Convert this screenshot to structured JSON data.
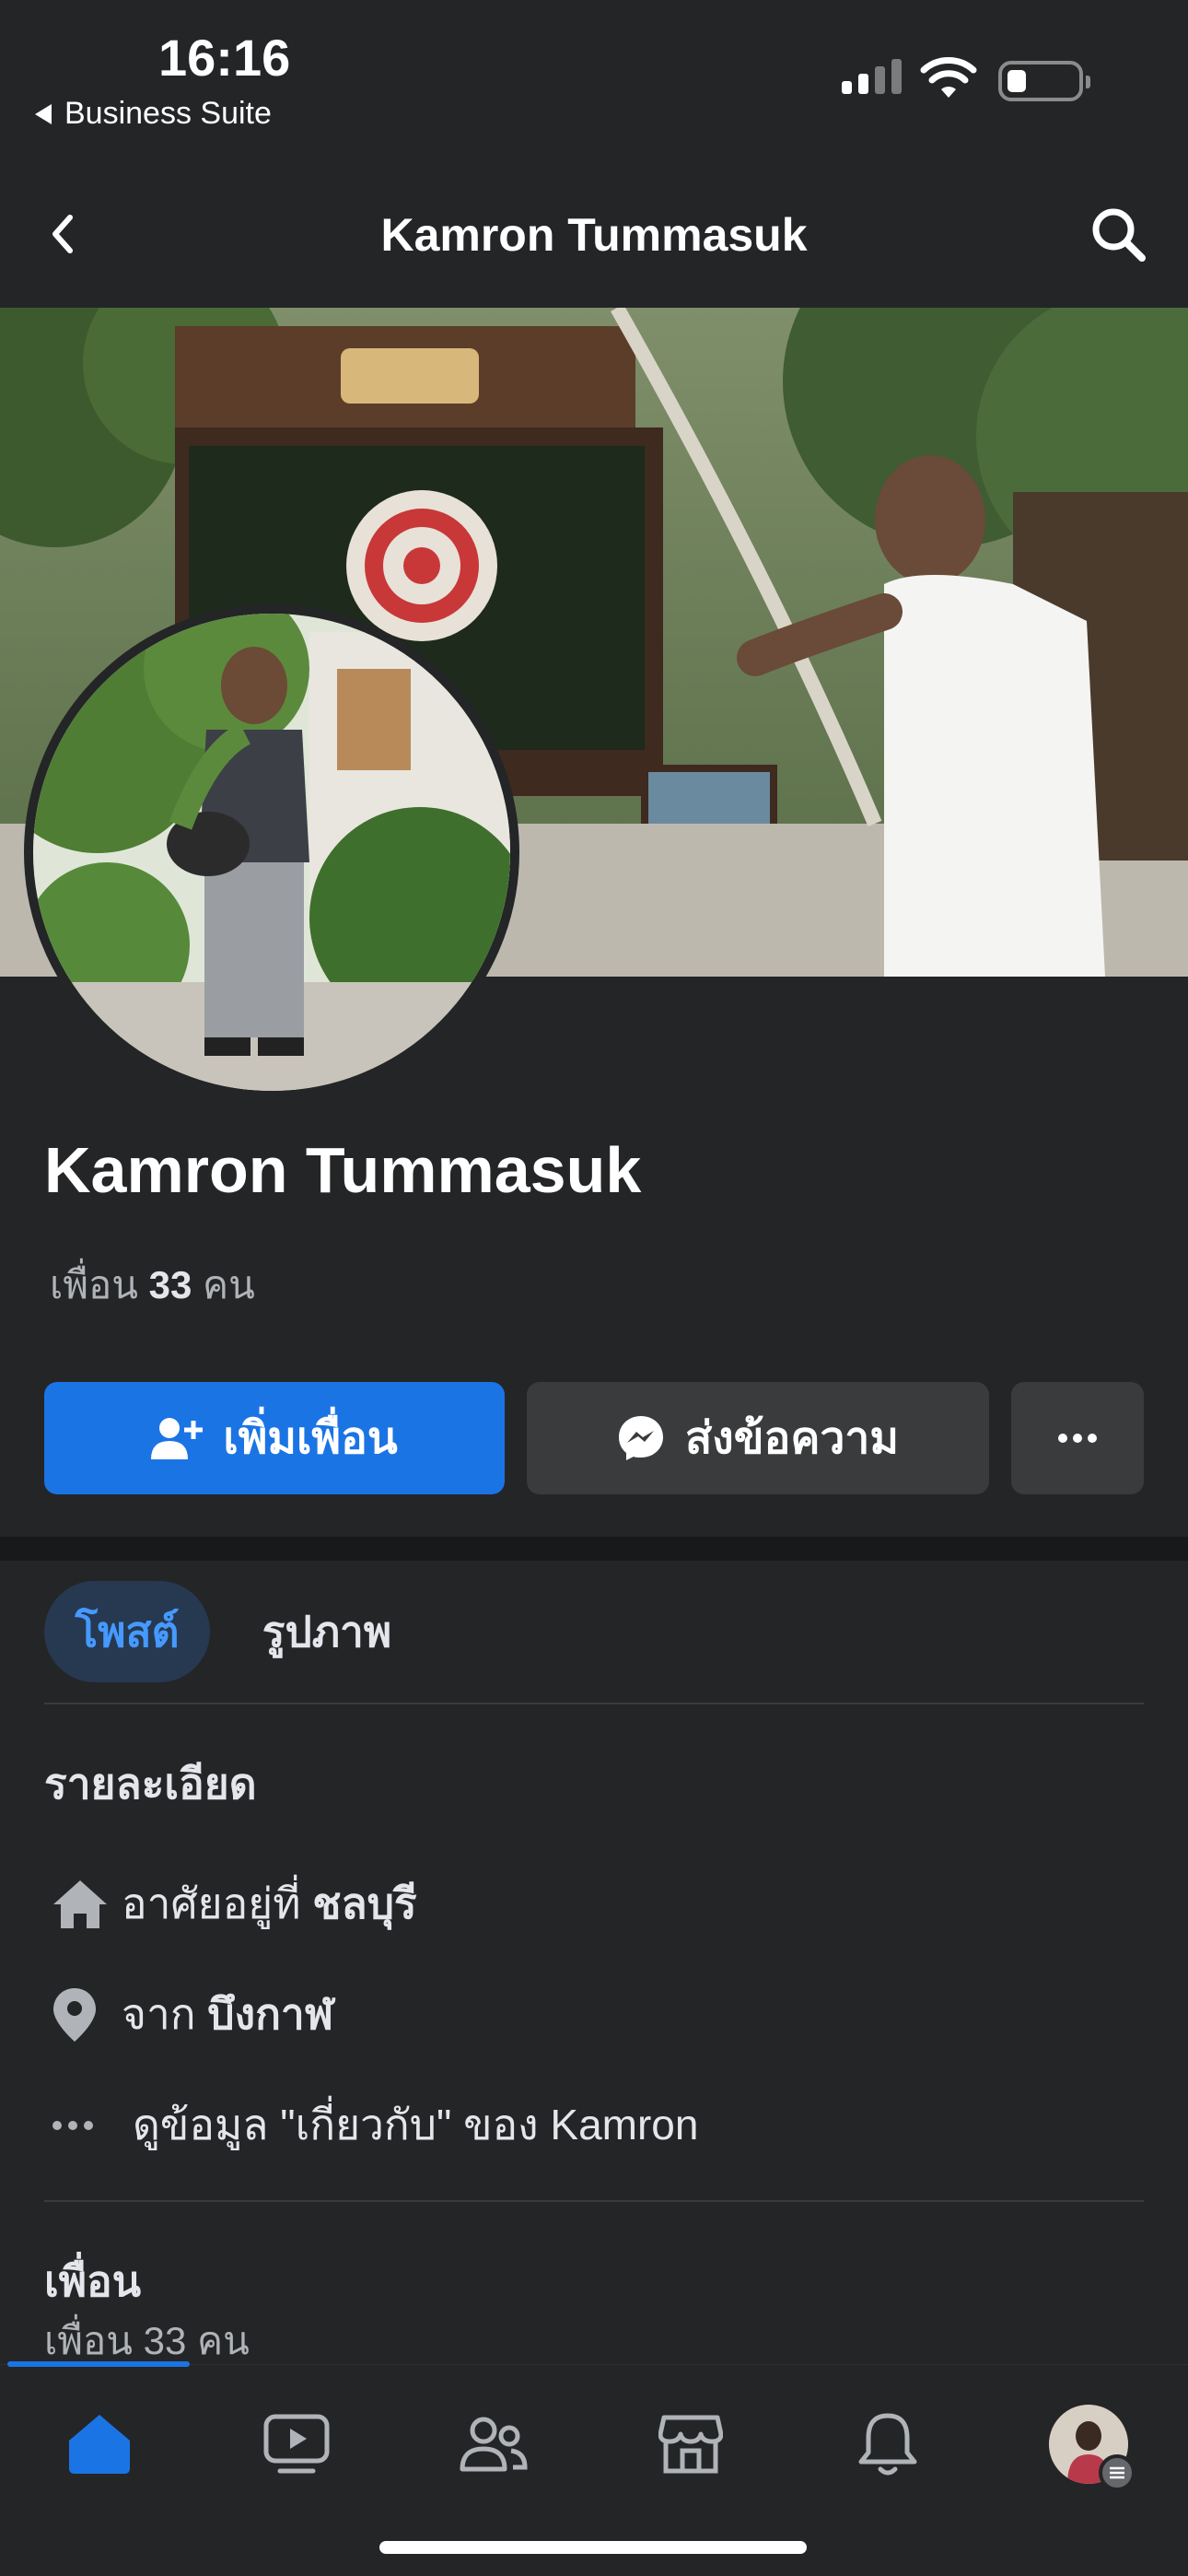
{
  "status_bar": {
    "time": "16:16",
    "back_app_label": "Business Suite",
    "signal_icon": "cellular-signal-icon",
    "wifi_icon": "wifi-icon",
    "battery_icon": "battery-icon",
    "battery_level": 0.2
  },
  "navbar": {
    "title": "Kamron Tummasuk",
    "back_icon": "chevron-left-icon",
    "search_icon": "search-icon"
  },
  "profile": {
    "name": "Kamron Tummasuk",
    "friends_prefix": "เพื่อน",
    "friends_count": "33",
    "friends_suffix": "คน"
  },
  "actions": {
    "add_friend_label": "เพิ่มเพื่อน",
    "message_label": "ส่งข้อความ",
    "more_icon": "more-dots-icon"
  },
  "tabs": [
    {
      "label": "โพสต์",
      "active": true
    },
    {
      "label": "รูปภาพ",
      "active": false
    }
  ],
  "details": {
    "title": "รายละเอียด",
    "lives_in_prefix": "อาศัยอยู่ที่",
    "lives_in_value": "ชลบุรี",
    "from_prefix": "จาก",
    "from_value": "บึงกาฬ",
    "about_link": "ดูข้อมูล \"เกี่ยวกับ\" ของ Kamron"
  },
  "friends_section": {
    "title": "เพื่อน",
    "count_text": "เพื่อน 33 คน"
  },
  "bottom_tabs": [
    {
      "name": "home",
      "icon": "home-icon",
      "active": true
    },
    {
      "name": "video",
      "icon": "video-icon",
      "active": false
    },
    {
      "name": "friends",
      "icon": "friends-icon",
      "active": false
    },
    {
      "name": "marketplace",
      "icon": "marketplace-icon",
      "active": false
    },
    {
      "name": "notifications",
      "icon": "bell-icon",
      "active": false
    },
    {
      "name": "menu",
      "icon": "avatar-menu-icon",
      "active": false
    }
  ],
  "colors": {
    "background": "#242527",
    "primary_blue": "#1b74e4",
    "secondary_button": "#3a3b3c",
    "active_tab_bg": "#263951",
    "active_tab_text": "#4599ff"
  }
}
